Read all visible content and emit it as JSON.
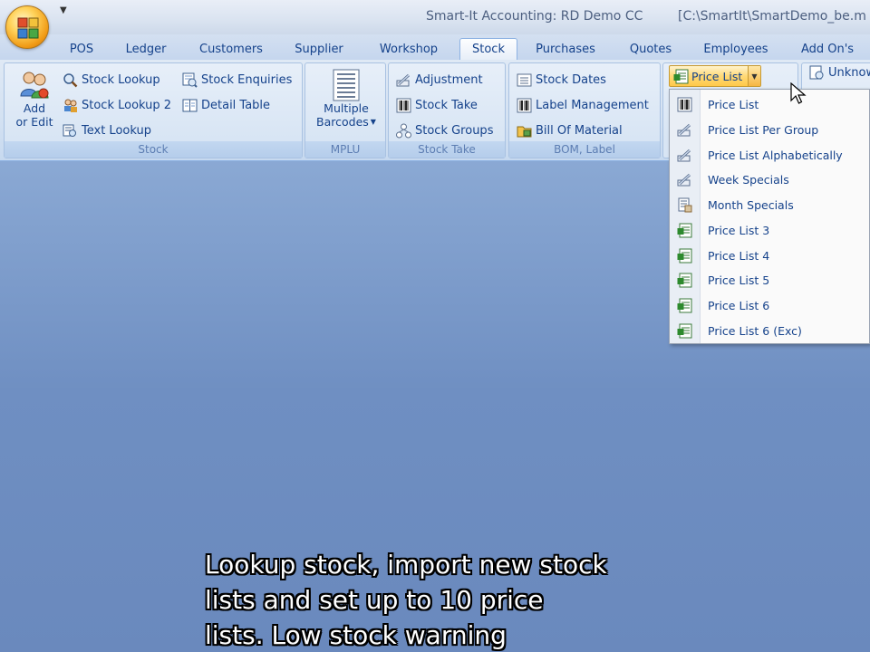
{
  "window": {
    "title": "Smart-It Accounting: RD Demo CC",
    "path": "[C:\\SmartIt\\SmartDemo_be.m"
  },
  "tabs": [
    {
      "label": "POS"
    },
    {
      "label": "Ledger"
    },
    {
      "label": "Customers"
    },
    {
      "label": "Supplier"
    },
    {
      "label": "Workshop"
    },
    {
      "label": "Stock"
    },
    {
      "label": "Purchases"
    },
    {
      "label": "Quotes"
    },
    {
      "label": "Employees"
    },
    {
      "label": "Add On's"
    }
  ],
  "ribbon": {
    "stock_group": {
      "label": "Stock",
      "add_edit_line1": "Add",
      "add_edit_line2": "or Edit",
      "stock_lookup": "Stock Lookup",
      "stock_lookup_2": "Stock Lookup 2",
      "text_lookup": "Text Lookup",
      "stock_enquiries": "Stock Enquiries",
      "detail_table": "Detail Table"
    },
    "mplu_group": {
      "label": "MPLU",
      "multiple_line1": "Multiple",
      "multiple_line2": "Barcodes"
    },
    "stocktake_group": {
      "label": "Stock Take",
      "adjustment": "Adjustment",
      "stock_take": "Stock Take",
      "stock_groups": "Stock Groups"
    },
    "bom_group": {
      "label": "BOM, Label",
      "stock_dates": "Stock Dates",
      "label_management": "Label Management",
      "bill_of_material": "Bill Of Material"
    },
    "price_list_button": "Price List",
    "unknown_button": "Unknown"
  },
  "price_menu": {
    "items": [
      {
        "label": "Price List",
        "icon": "barcode-icon"
      },
      {
        "label": "Price List Per Group",
        "icon": "pencil-stack-icon"
      },
      {
        "label": "Price List Alphabetically",
        "icon": "pencil-stack-icon"
      },
      {
        "label": "Week Specials",
        "icon": "pencil-stack-icon"
      },
      {
        "label": "Month Specials",
        "icon": "document-list-icon"
      },
      {
        "label": "Price List 3",
        "icon": "excel-sheet-icon"
      },
      {
        "label": "Price List 4",
        "icon": "excel-sheet-icon"
      },
      {
        "label": "Price List 5",
        "icon": "excel-sheet-icon"
      },
      {
        "label": "Price List 6",
        "icon": "excel-sheet-icon"
      },
      {
        "label": "Price List 6 (Exc)",
        "icon": "excel-sheet-icon"
      }
    ]
  },
  "subtitle": {
    "line1": "Lookup stock, import new stock",
    "line2": "lists and set up to 10 price",
    "line3": "lists. Low stock warning"
  }
}
